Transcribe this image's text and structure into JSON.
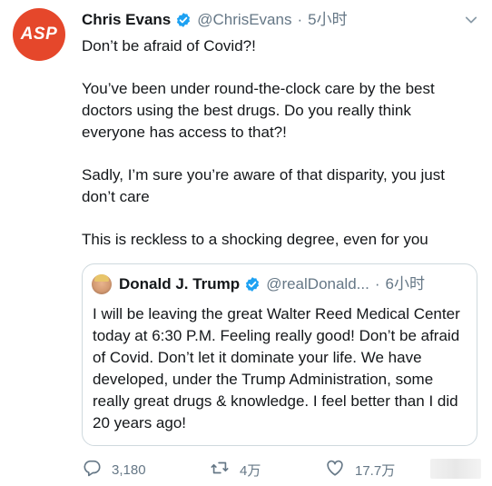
{
  "author": {
    "avatar_text": "ASP",
    "display_name": "Chris Evans",
    "handle": "@ChrisEvans",
    "separator": "·",
    "time": "5小时"
  },
  "body": {
    "paragraphs": [
      "Don’t be afraid of Covid?!",
      "You’ve been under round-the-clock care by the best doctors using the best drugs. Do you really think everyone has access to that?!",
      "Sadly, I’m sure you’re aware of that disparity, you just don’t care",
      "This is reckless to a shocking degree, even for you"
    ]
  },
  "quote": {
    "display_name": "Donald J. Trump",
    "handle": "@realDonald...",
    "separator": "·",
    "time": "6小时",
    "text": "I will be leaving the great Walter Reed Medical Center today at 6:30 P.M. Feeling really good! Don’t be afraid of Covid. Don’t let it dominate your life. We have developed, under the Trump Administration, some really great drugs & knowledge. I feel better than I did 20 years ago!"
  },
  "actions": {
    "replies": "3,180",
    "retweets": "4万",
    "likes": "17.7万"
  },
  "colors": {
    "accent_verified": "#1da1f2",
    "avatar_bg": "#e5472b",
    "muted_text": "#657786",
    "border": "#cfd9de"
  },
  "icons": [
    "verified-badge-icon",
    "chevron-down-icon",
    "reply-icon",
    "retweet-icon",
    "like-icon",
    "share-icon"
  ]
}
